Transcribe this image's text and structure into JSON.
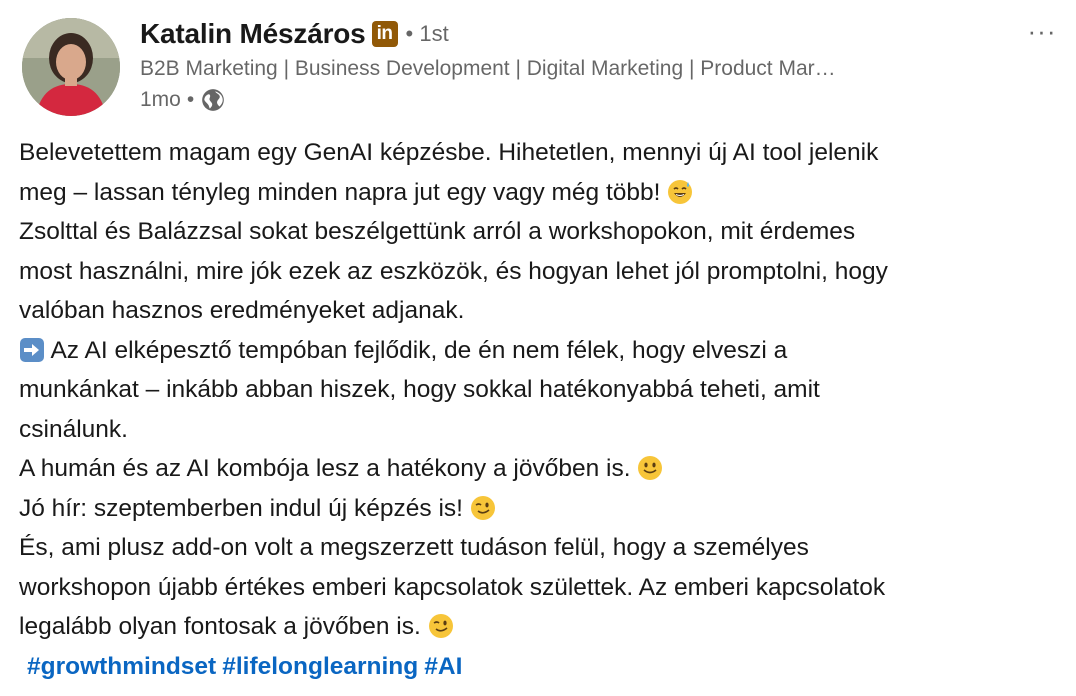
{
  "author": {
    "name": "Katalin Mészáros",
    "badge": "in",
    "degree": "1st",
    "headline": "B2B Marketing | Business Development | Digital Marketing | Product Mar…",
    "time": "1mo",
    "separator": "•",
    "visibility_icon": "globe-icon"
  },
  "menu": {
    "more_label": "···"
  },
  "colors": {
    "link": "#0a66c2",
    "badge": "#915907"
  },
  "post": {
    "lines": [
      "Belevetettem magam egy GenAI képzésbe. Hihetetlen, mennyi új AI tool jelenik",
      "meg – lassan tényleg minden napra jut egy vagy még több!",
      "Zsolttal és Balázzsal sokat beszélgettünk arról a workshopokon, mit érdemes",
      "most használni, mire jók ezek az eszközök, és hogyan lehet jól promptolni, hogy",
      "valóban hasznos eredményeket adjanak.",
      "Az AI elképesztő tempóban fejlődik, de én nem félek, hogy elveszi a",
      "munkánkat – inkább abban hiszek, hogy sokkal hatékonyabbá teheti, amit",
      "csinálunk.",
      "A humán és az AI kombója lesz a hatékony a jövőben is.",
      "Jó hír: szeptemberben indul új képzés is!",
      "És, ami plusz add-on volt a megszerzett tudáson felül, hogy a személyes",
      "workshopon újabb értékes emberi kapcsolatok születtek. Az emberi kapcsolatok",
      "legalább olyan fontosak a jövőben is."
    ],
    "emoji_icons": [
      "grinning-sweat-emoji",
      "right-arrow-emoji",
      "slight-smile-emoji",
      "wink-emoji"
    ],
    "hashtags": [
      "#growthmindset",
      "#lifelonglearning",
      "#AI"
    ]
  }
}
